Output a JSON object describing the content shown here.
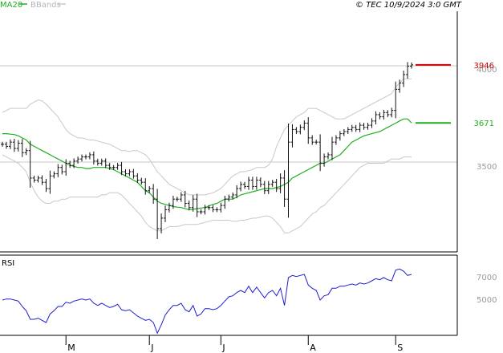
{
  "header": {
    "ma_label": "MA20",
    "bbands_label": "BBands",
    "copyright": "© TEC 10/9/2024 3:0 GMT"
  },
  "colors": {
    "ma": "#1fae1f",
    "bands": "#c8c8c8",
    "price": "#111111",
    "rsi": "#1f1fd0",
    "last_price_marker": "#cc0000",
    "ma_marker": "#1fae1f",
    "axis": "#000000",
    "grid": "#c8c8c8",
    "axis_label": "#888888"
  },
  "chart_data": [
    {
      "type": "line",
      "title": "",
      "xlabel": "",
      "ylabel": "",
      "ylim": [
        3060,
        4200
      ],
      "y_ticks": [
        3500,
        4000
      ],
      "y_tick_labels": [
        "3500",
        "4000"
      ],
      "x_month_labels": [
        {
          "label": "M",
          "index": 16
        },
        {
          "label": "J",
          "index": 37
        },
        {
          "label": "J",
          "index": 55
        },
        {
          "label": "A",
          "index": 77
        },
        {
          "label": "S",
          "index": 99
        }
      ],
      "series": [
        {
          "name": "price",
          "style": "ohlc",
          "values": [
            3570,
            3560,
            3580,
            3550,
            3575,
            3530,
            3540,
            3410,
            3400,
            3410,
            3390,
            3360,
            3420,
            3430,
            3460,
            3440,
            3480,
            3470,
            3490,
            3500,
            3510,
            3510,
            3520,
            3490,
            3480,
            3490,
            3470,
            3460,
            3460,
            3470,
            3440,
            3430,
            3440,
            3420,
            3400,
            3390,
            3350,
            3360,
            3310,
            3170,
            3220,
            3260,
            3280,
            3310,
            3310,
            3330,
            3290,
            3270,
            3310,
            3250,
            3250,
            3270,
            3270,
            3260,
            3260,
            3280,
            3310,
            3320,
            3330,
            3360,
            3380,
            3370,
            3400,
            3370,
            3400,
            3380,
            3350,
            3380,
            3390,
            3360,
            3410,
            3310,
            3580,
            3640,
            3630,
            3650,
            3670,
            3600,
            3580,
            3580,
            3480,
            3510,
            3520,
            3580,
            3600,
            3620,
            3630,
            3640,
            3650,
            3640,
            3660,
            3650,
            3660,
            3680,
            3710,
            3700,
            3720,
            3710,
            3730,
            3830,
            3860,
            3900,
            3940,
            3946
          ]
        },
        {
          "name": "MA20",
          "values": [
            3620,
            3620,
            3618,
            3616,
            3610,
            3600,
            3590,
            3570,
            3560,
            3550,
            3540,
            3530,
            3520,
            3510,
            3500,
            3490,
            3480,
            3470,
            3465,
            3460,
            3460,
            3455,
            3455,
            3460,
            3460,
            3460,
            3460,
            3455,
            3450,
            3440,
            3430,
            3420,
            3410,
            3400,
            3390,
            3370,
            3350,
            3340,
            3320,
            3300,
            3290,
            3285,
            3280,
            3275,
            3272,
            3270,
            3265,
            3260,
            3262,
            3265,
            3268,
            3270,
            3278,
            3285,
            3290,
            3300,
            3310,
            3310,
            3310,
            3320,
            3330,
            3335,
            3340,
            3345,
            3350,
            3355,
            3360,
            3360,
            3360,
            3365,
            3370,
            3380,
            3390,
            3410,
            3420,
            3430,
            3440,
            3450,
            3460,
            3470,
            3480,
            3480,
            3490,
            3500,
            3510,
            3520,
            3540,
            3560,
            3580,
            3590,
            3600,
            3610,
            3615,
            3620,
            3625,
            3630,
            3640,
            3650,
            3660,
            3670,
            3680,
            3690,
            3690,
            3671
          ]
        },
        {
          "name": "BBands upper",
          "values": [
            3720,
            3730,
            3740,
            3740,
            3740,
            3740,
            3740,
            3760,
            3770,
            3780,
            3775,
            3760,
            3740,
            3720,
            3700,
            3670,
            3640,
            3620,
            3610,
            3600,
            3600,
            3595,
            3590,
            3590,
            3585,
            3580,
            3575,
            3570,
            3560,
            3550,
            3540,
            3540,
            3535,
            3540,
            3540,
            3530,
            3520,
            3500,
            3470,
            3440,
            3420,
            3400,
            3380,
            3370,
            3360,
            3350,
            3340,
            3330,
            3330,
            3330,
            3330,
            3330,
            3335,
            3340,
            3350,
            3360,
            3380,
            3400,
            3420,
            3430,
            3440,
            3440,
            3445,
            3450,
            3460,
            3460,
            3460,
            3470,
            3500,
            3560,
            3600,
            3640,
            3660,
            3680,
            3700,
            3710,
            3720,
            3740,
            3740,
            3740,
            3730,
            3720,
            3710,
            3700,
            3690,
            3690,
            3690,
            3700,
            3710,
            3720,
            3730,
            3740,
            3750,
            3760,
            3770,
            3780,
            3790,
            3800,
            3810,
            3840,
            3860,
            3880,
            3880,
            3880
          ]
        },
        {
          "name": "BBands lower",
          "values": [
            3520,
            3510,
            3500,
            3490,
            3480,
            3460,
            3440,
            3390,
            3350,
            3320,
            3300,
            3290,
            3290,
            3300,
            3300,
            3310,
            3310,
            3320,
            3320,
            3320,
            3320,
            3320,
            3320,
            3320,
            3320,
            3330,
            3330,
            3340,
            3340,
            3340,
            3330,
            3310,
            3290,
            3270,
            3250,
            3230,
            3200,
            3180,
            3170,
            3160,
            3160,
            3170,
            3180,
            3180,
            3180,
            3185,
            3190,
            3190,
            3190,
            3190,
            3195,
            3200,
            3205,
            3210,
            3210,
            3210,
            3210,
            3210,
            3205,
            3205,
            3210,
            3210,
            3215,
            3220,
            3220,
            3225,
            3230,
            3230,
            3220,
            3200,
            3180,
            3150,
            3150,
            3160,
            3170,
            3180,
            3200,
            3220,
            3240,
            3250,
            3270,
            3280,
            3300,
            3320,
            3340,
            3360,
            3380,
            3400,
            3420,
            3440,
            3460,
            3470,
            3480,
            3480,
            3480,
            3480,
            3480,
            3490,
            3500,
            3500,
            3500,
            3510,
            3510,
            3510
          ]
        }
      ],
      "markers": [
        {
          "name": "last-price",
          "value": 3946,
          "label": "3946"
        },
        {
          "name": "ma20",
          "value": 3671,
          "label": "3671"
        }
      ]
    },
    {
      "type": "line",
      "title": "RSI",
      "ylim": [
        20,
        95
      ],
      "y_ticks": [
        50,
        70
      ],
      "y_tick_labels": [
        "5000",
        "7000"
      ],
      "series": [
        {
          "name": "RSI",
          "values": [
            53,
            54,
            54,
            53,
            52,
            47,
            43,
            35,
            35,
            36,
            34,
            32,
            40,
            43,
            47,
            47,
            51,
            50,
            52,
            53,
            54,
            53,
            54,
            50,
            48,
            50,
            48,
            46,
            47,
            49,
            44,
            43,
            44,
            41,
            38,
            36,
            34,
            35,
            32,
            22,
            30,
            39,
            44,
            48,
            48,
            50,
            44,
            42,
            48,
            38,
            40,
            45,
            45,
            44,
            45,
            48,
            52,
            56,
            57,
            60,
            62,
            60,
            66,
            60,
            65,
            60,
            55,
            60,
            62,
            57,
            64,
            48,
            74,
            76,
            75,
            76,
            77,
            67,
            64,
            62,
            53,
            57,
            58,
            64,
            64,
            66,
            66,
            67,
            68,
            67,
            69,
            68,
            69,
            71,
            73,
            72,
            74,
            72,
            71,
            81,
            82,
            80,
            76,
            77
          ]
        }
      ]
    }
  ]
}
